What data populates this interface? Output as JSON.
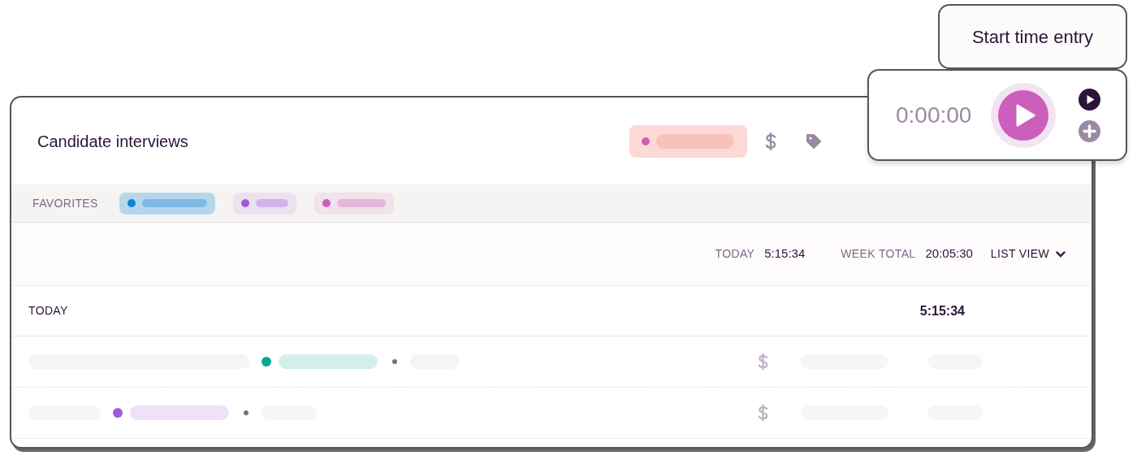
{
  "entry": {
    "description": "Candidate interviews",
    "project": {
      "color": "#cc5fbb"
    }
  },
  "timer": {
    "time": "0:00:00",
    "tooltip": "Start time entry"
  },
  "favorites": {
    "label": "FAVORITES",
    "items": [
      {
        "color": "#0b83d9"
      },
      {
        "color": "#9e5bd9"
      },
      {
        "color": "#cc5fbb"
      }
    ]
  },
  "summary": [
    {
      "label": "TODAY",
      "value": "5:15:34"
    },
    {
      "label": "WEEK TOTAL",
      "value": "20:05:30"
    }
  ],
  "view": {
    "label": "LIST VIEW"
  },
  "group": {
    "label": "TODAY",
    "total": "5:15:34"
  },
  "rows": [
    {
      "color": "#06a893"
    },
    {
      "color": "#9e5bd9"
    }
  ]
}
